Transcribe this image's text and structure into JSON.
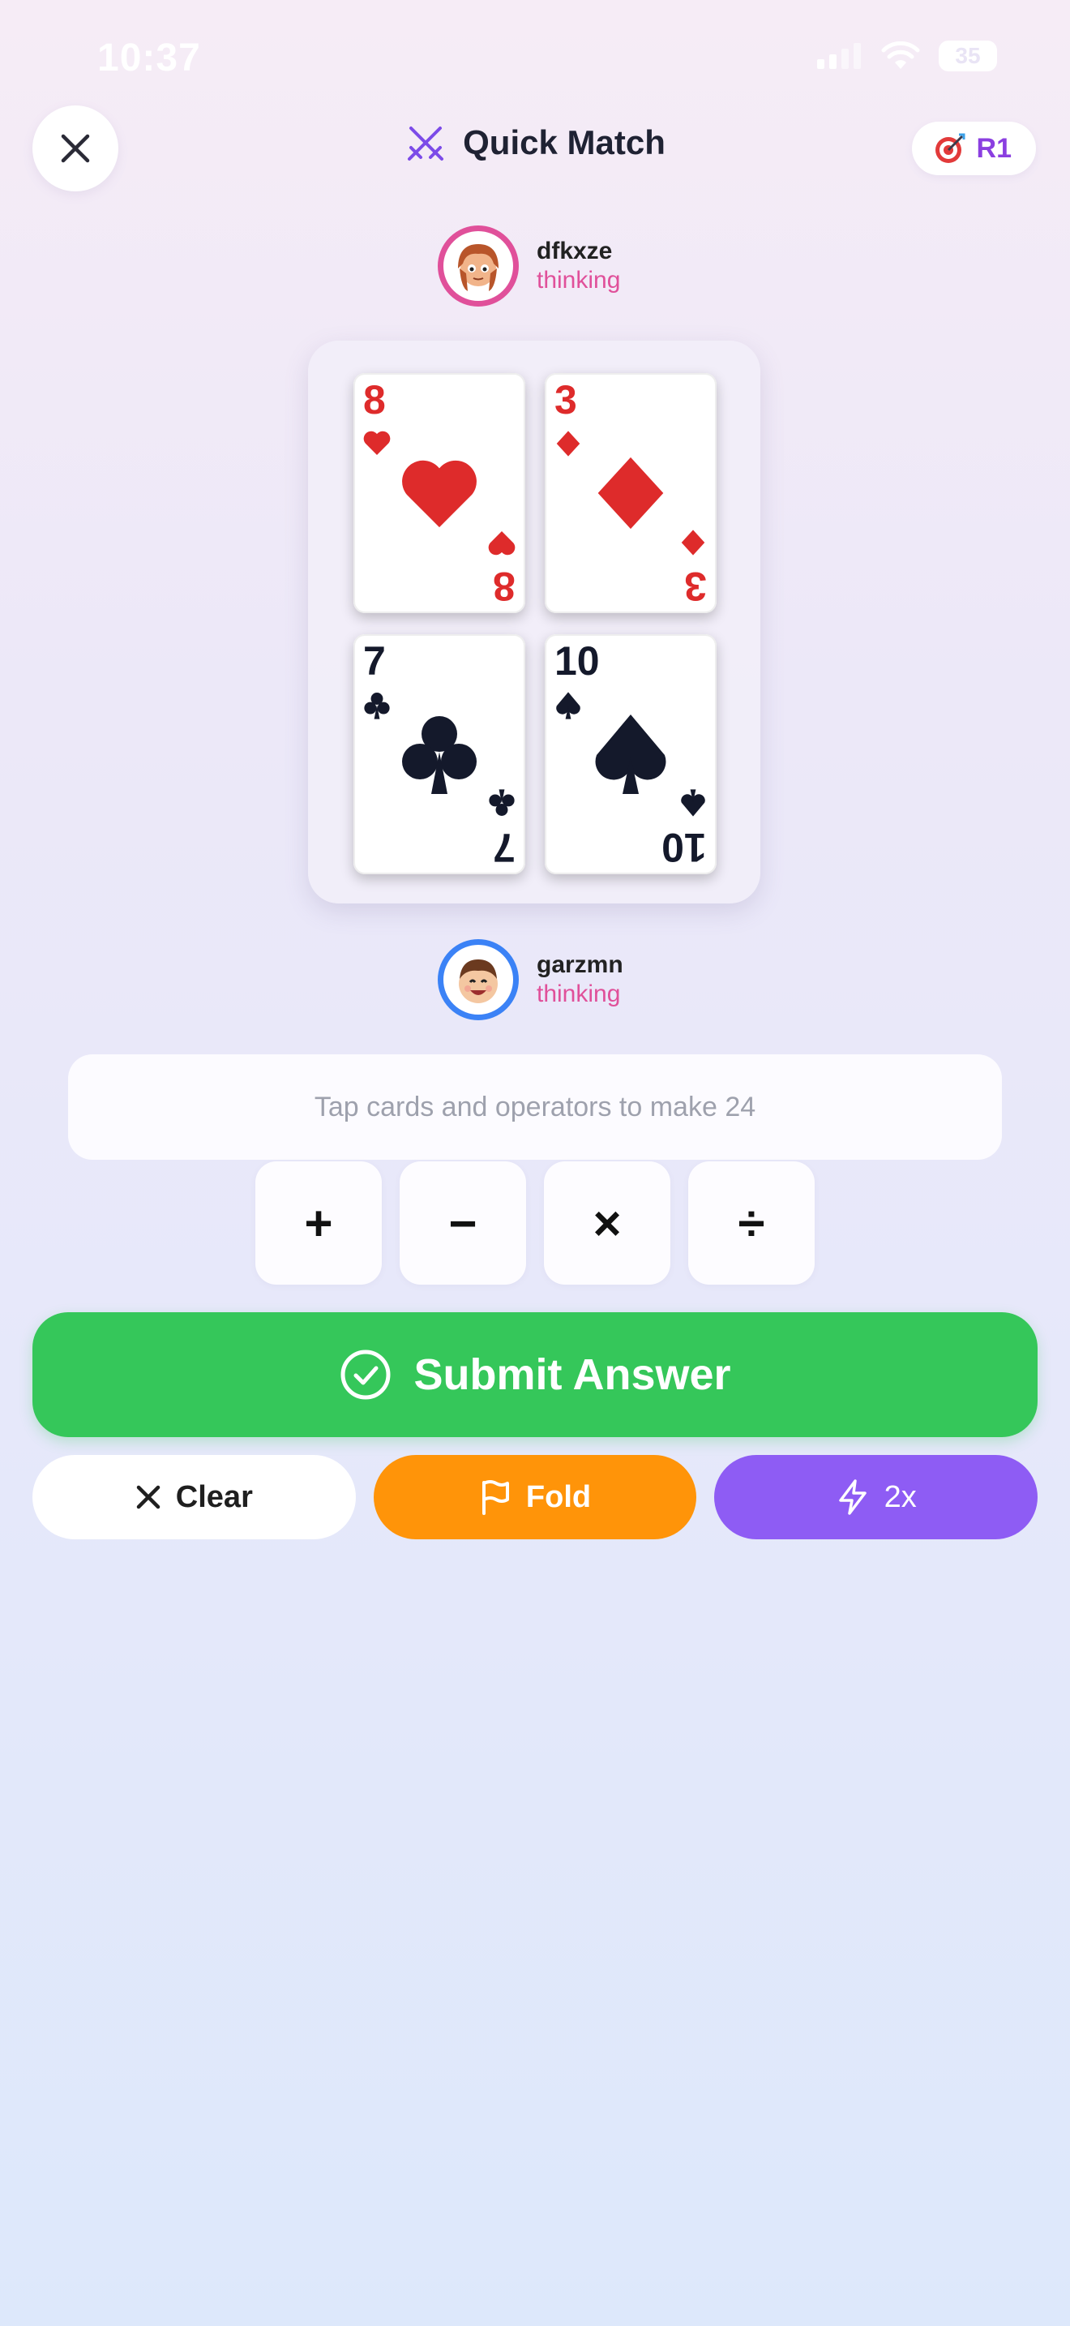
{
  "status": {
    "time": "10:37",
    "battery": "35"
  },
  "header": {
    "title": "Quick Match",
    "round": "R1"
  },
  "opponent": {
    "name": "dfkxze",
    "status": "thinking",
    "ring_color": "#e0509a"
  },
  "player": {
    "name": "garzmn",
    "status": "thinking",
    "ring_color": "#3b82f6"
  },
  "cards": [
    {
      "rank": "8",
      "suit": "hearts",
      "color": "#de2b2b"
    },
    {
      "rank": "3",
      "suit": "diamonds",
      "color": "#de2b2b"
    },
    {
      "rank": "7",
      "suit": "clubs",
      "color": "#14192b"
    },
    {
      "rank": "10",
      "suit": "spades",
      "color": "#14192b"
    }
  ],
  "expression": {
    "placeholder": "Tap cards and operators to make 24"
  },
  "operators": [
    "+",
    "−",
    "×",
    "÷"
  ],
  "actions": {
    "submit": "Submit Answer",
    "clear": "Clear",
    "fold": "Fold",
    "boost": "2x"
  },
  "colors": {
    "submit": "#35c75a",
    "fold": "#ff9409",
    "boost": "#8e5cf4",
    "accent": "#8b3fe0"
  }
}
